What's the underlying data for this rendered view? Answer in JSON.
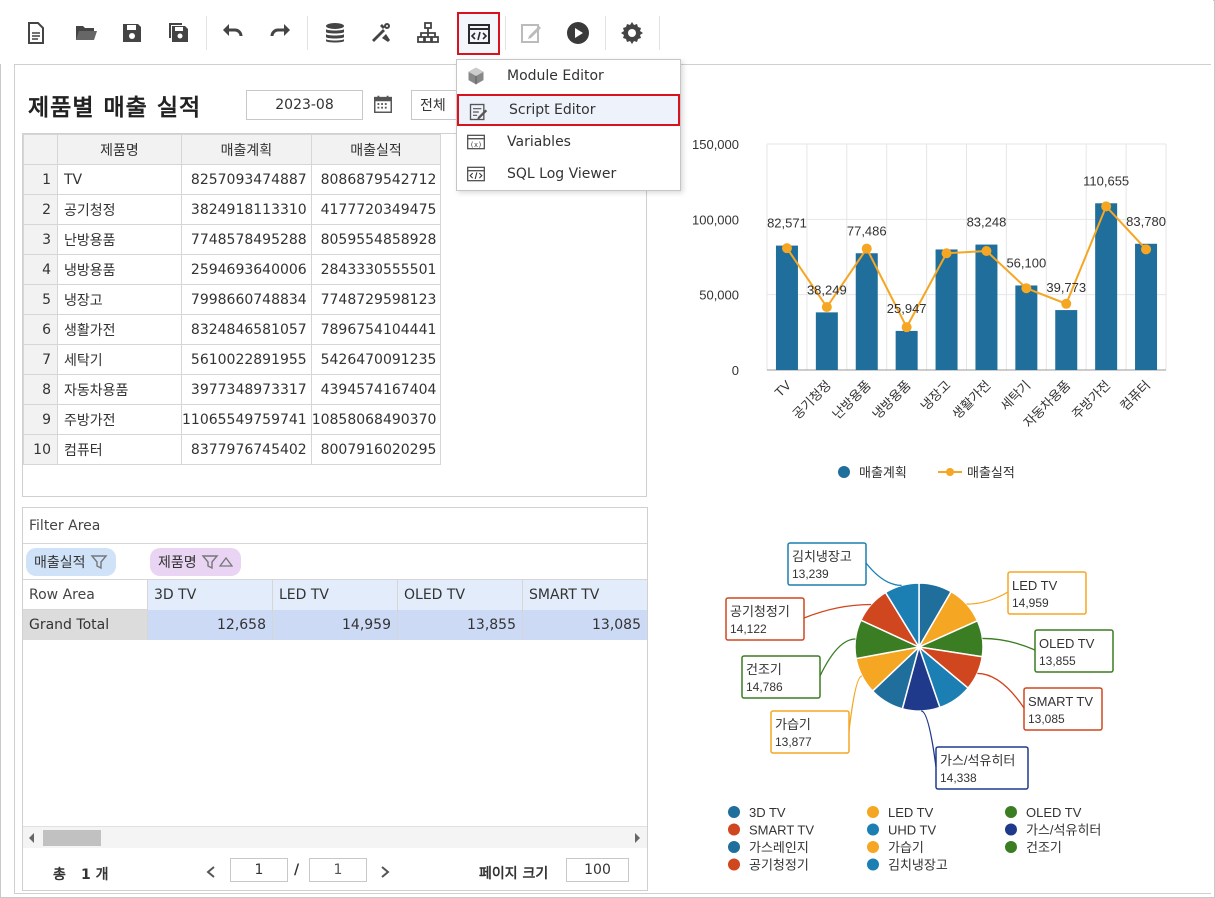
{
  "toolbar": {
    "buttons": [
      "new-file-icon",
      "open-folder-icon",
      "save-icon",
      "save-all-icon",
      "undo-icon",
      "redo-icon",
      "database-icon",
      "tools-icon",
      "hierarchy-icon",
      "script-code-icon",
      "edit-icon",
      "run-icon",
      "settings-icon"
    ]
  },
  "menu": {
    "items": [
      {
        "label": "Module Editor",
        "icon": "module-cube-icon"
      },
      {
        "label": "Script Editor",
        "icon": "script-edit-icon"
      },
      {
        "label": "Variables",
        "icon": "variables-icon"
      },
      {
        "label": "SQL Log Viewer",
        "icon": "sql-log-icon"
      }
    ]
  },
  "page": {
    "title": "제품별 매출 실적",
    "date": "2023-08",
    "select_value": "전체"
  },
  "grid": {
    "columns": [
      "제품명",
      "매출계획",
      "매출실적"
    ],
    "rows": [
      {
        "n": "1",
        "name": "TV",
        "plan": "8257093474887",
        "actual": "8086879542712"
      },
      {
        "n": "2",
        "name": "공기청정",
        "plan": "3824918113310",
        "actual": "4177720349475"
      },
      {
        "n": "3",
        "name": "난방용품",
        "plan": "7748578495288",
        "actual": "8059554858928"
      },
      {
        "n": "4",
        "name": "냉방용품",
        "plan": "2594693640006",
        "actual": "2843330555501"
      },
      {
        "n": "5",
        "name": "냉장고",
        "plan": "7998660748834",
        "actual": "7748729598123"
      },
      {
        "n": "6",
        "name": "생활가전",
        "plan": "8324846581057",
        "actual": "7896754104441"
      },
      {
        "n": "7",
        "name": "세탁기",
        "plan": "5610022891955",
        "actual": "5426470091235"
      },
      {
        "n": "8",
        "name": "자동차용품",
        "plan": "3977348973317",
        "actual": "4394574167404"
      },
      {
        "n": "9",
        "name": "주방가전",
        "plan": "11065549759741",
        "actual": "10858068490370"
      },
      {
        "n": "10",
        "name": "컴퓨터",
        "plan": "8377976745402",
        "actual": "8007916020295"
      }
    ]
  },
  "pivot": {
    "filter_area": "Filter Area",
    "chip_measure": "매출실적",
    "chip_dim": "제품명",
    "row_area": "Row Area",
    "columns": [
      "3D TV",
      "LED TV",
      "OLED TV",
      "SMART TV"
    ],
    "grand_total_label": "Grand Total",
    "grand_total": [
      "12,658",
      "14,959",
      "13,855",
      "13,085"
    ],
    "total_label": "총",
    "total_count": "1 개",
    "page_current": "1",
    "page_sep": "/",
    "page_total": "1",
    "page_size_label": "페이지 크기",
    "page_size": "100"
  },
  "colors": {
    "bar": "#1f6e9c",
    "line": "#f5a623",
    "accent_red": "#d9131e"
  },
  "chart_data": [
    {
      "type": "bar",
      "categories": [
        "TV",
        "공기청정",
        "난방용품",
        "냉방용품",
        "냉장고",
        "생활가전",
        "세탁기",
        "자동차용품",
        "주방가전",
        "컴퓨터"
      ],
      "series": [
        {
          "name": "매출계획",
          "type": "bar",
          "values": [
            82571,
            38249,
            77486,
            25947,
            80000,
            83248,
            56100,
            39773,
            110655,
            83780
          ]
        },
        {
          "name": "매출실적",
          "type": "line",
          "values": [
            80869,
            41777,
            80596,
            28433,
            77487,
            78968,
            54265,
            43946,
            108581,
            80079
          ]
        }
      ],
      "data_labels": [
        "82,571",
        "38,249",
        "77,486",
        "25,947",
        "",
        "83,248",
        "56,100",
        "39,773",
        "110,655",
        "83,780"
      ],
      "yticks": [
        "0",
        "50,000",
        "100,000",
        "150,000"
      ],
      "ylim": [
        0,
        150000
      ],
      "grid": true,
      "legend": "bottom"
    },
    {
      "type": "pie",
      "slices": [
        {
          "name": "3D TV",
          "value": 12658,
          "color": "#1f6e9c",
          "label": ""
        },
        {
          "name": "LED TV",
          "value": 14959,
          "color": "#f5a623",
          "label": "14,959"
        },
        {
          "name": "OLED TV",
          "value": 13855,
          "color": "#3a7d22",
          "label": "13,855"
        },
        {
          "name": "SMART TV",
          "value": 13085,
          "color": "#d0461e",
          "label": "13,085"
        },
        {
          "name": "UHD TV",
          "value": 13000,
          "color": "#1b7fb3",
          "label": ""
        },
        {
          "name": "가스/석유히터",
          "value": 14338,
          "color": "#1f3a8a",
          "label": "14,338"
        },
        {
          "name": "가스레인지",
          "value": 13200,
          "color": "#1f6e9c",
          "label": ""
        },
        {
          "name": "가습기",
          "value": 13877,
          "color": "#f5a623",
          "label": "13,877"
        },
        {
          "name": "건조기",
          "value": 14786,
          "color": "#3a7d22",
          "label": "14,786"
        },
        {
          "name": "공기청정기",
          "value": 14122,
          "color": "#d0461e",
          "label": "14,122"
        },
        {
          "name": "김치냉장고",
          "value": 13239,
          "color": "#1b7fb3",
          "label": "13,239"
        }
      ],
      "legend": "bottom"
    }
  ]
}
